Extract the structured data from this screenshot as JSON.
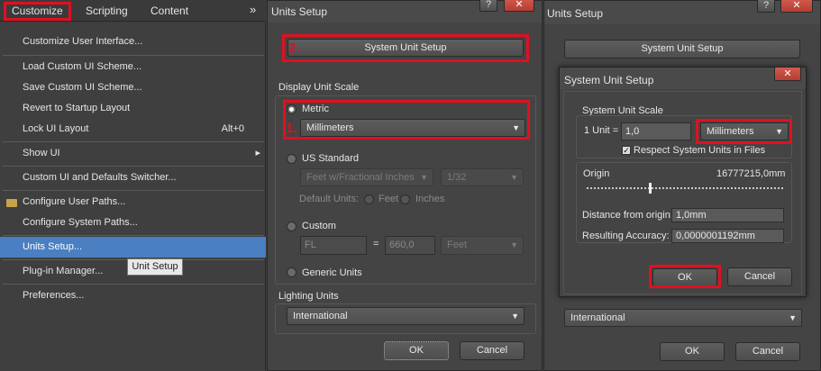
{
  "menubar": {
    "items": [
      "Customize",
      "Scripting",
      "Content"
    ],
    "overflow": "»"
  },
  "menu": {
    "items": [
      {
        "label": "Customize User Interface...",
        "shortcut": ""
      },
      {
        "label": "Load Custom UI Scheme...",
        "shortcut": ""
      },
      {
        "label": "Save Custom UI Scheme...",
        "shortcut": ""
      },
      {
        "label": "Revert to Startup Layout",
        "shortcut": ""
      },
      {
        "label": "Lock UI Layout",
        "shortcut": "Alt+0"
      },
      {
        "label": "Show UI",
        "shortcut": ""
      },
      {
        "label": "Custom UI and Defaults Switcher...",
        "shortcut": ""
      },
      {
        "label": "Configure User Paths...",
        "shortcut": ""
      },
      {
        "label": "Configure System Paths...",
        "shortcut": ""
      },
      {
        "label": "Units Setup...",
        "shortcut": ""
      },
      {
        "label": "Plug-in Manager...",
        "shortcut": ""
      },
      {
        "label": "Preferences...",
        "shortcut": ""
      }
    ],
    "submenu_arrow": "▸",
    "tooltip": "Unit Setup",
    "highlight_color": "#4a7fc1"
  },
  "units_dialog": {
    "title": "Units Setup",
    "help_btn": "?",
    "close_btn": "✕",
    "system_unit_setup": "System Unit Setup",
    "display_unit_scale": "Display Unit Scale",
    "metric": "Metric",
    "metric_value": "Millimeters",
    "us_standard": "US Standard",
    "us_value": "Feet w/Fractional Inches",
    "us_fraction": "1/32",
    "default_units": "Default Units:",
    "feet": "Feet",
    "inches": "Inches",
    "custom": "Custom",
    "custom_name": "FL",
    "equals": "=",
    "custom_value": "660,0",
    "custom_unit": "Feet",
    "generic_units": "Generic Units",
    "lighting_units": "Lighting Units",
    "lighting_value": "International",
    "ok": "OK",
    "cancel": "Cancel",
    "step1": "1.",
    "step2": "2."
  },
  "back_dialog": {
    "title": "Units Setup",
    "help_btn": "?",
    "close_btn": "✕",
    "system_unit_setup": "System Unit Setup",
    "lighting_value": "International",
    "ok": "OK",
    "cancel": "Cancel"
  },
  "sys_dialog": {
    "title": "System Unit Setup",
    "close_btn": "✕",
    "scale_group": "System Unit Scale",
    "one_unit": "1 Unit =",
    "unit_value": "1,0",
    "unit_type": "Millimeters",
    "respect": "Respect System Units in Files",
    "origin": "Origin",
    "origin_value": "16777215,0mm",
    "distance_label": "Distance from origin:",
    "distance_value": "1,0mm",
    "accuracy_label": "Resulting Accuracy:",
    "accuracy_value": "0,0000001192mm",
    "ok": "OK",
    "cancel": "Cancel"
  },
  "colors": {
    "accent_red": "#e01020",
    "menu_highlight": "#4a7fc1"
  }
}
